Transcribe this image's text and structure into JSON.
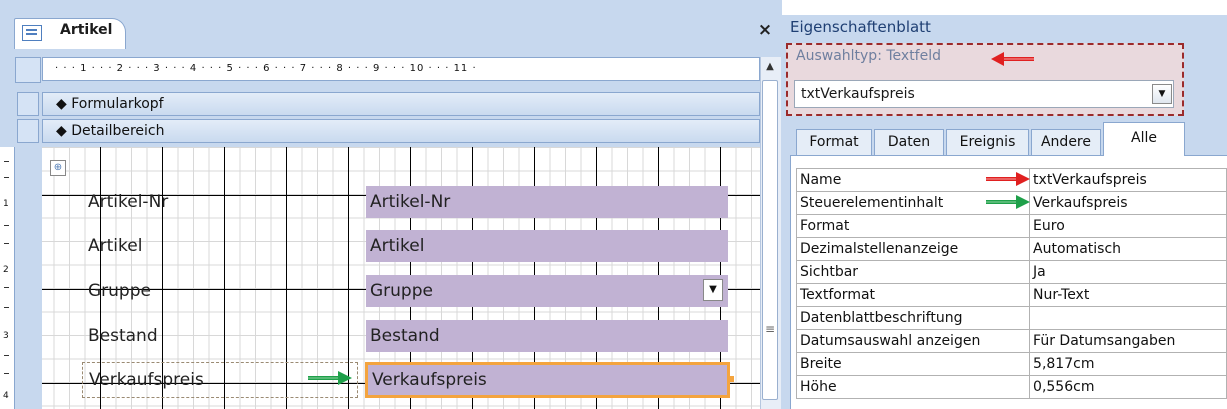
{
  "form_tab": {
    "title": "Artikel",
    "close": "×"
  },
  "ruler": {
    "marks": "· · · 1 · · · 2 · · · 3 · · · 4 · · · 5 · · · 6 · · · 7 · · · 8 · · · 9 · · · 10 · · · 11 ·"
  },
  "vruler": {
    "n1": "1",
    "n2": "2",
    "n3": "3",
    "n4": "4"
  },
  "sections": {
    "header": "Formularkopf",
    "detail": "Detailbereich",
    "marker": "◆"
  },
  "controls": {
    "labels": [
      "Artikel-Nr",
      "Artikel",
      "Gruppe",
      "Bestand",
      "Verkaufspreis"
    ],
    "fields": [
      "Artikel-Nr",
      "Artikel",
      "Gruppe",
      "Bestand",
      "Verkaufspreis"
    ],
    "dropdown_glyph": "▼"
  },
  "scroll": {
    "up": "▲",
    "grip": "≡"
  },
  "property_sheet": {
    "title": "Eigenschaftenblatt",
    "selection_type": "Auswahltyp:  Textfeld",
    "object": "txtVerkaufspreis",
    "tabs": [
      "Format",
      "Daten",
      "Ereignis",
      "Andere",
      "Alle"
    ],
    "active_tab": "Alle",
    "rows": [
      {
        "key": "Name",
        "value": "txtVerkaufspreis"
      },
      {
        "key": "Steuerelementinhalt",
        "value": "Verkaufspreis"
      },
      {
        "key": "Format",
        "value": "Euro"
      },
      {
        "key": "Dezimalstellenanzeige",
        "value": "Automatisch"
      },
      {
        "key": "Sichtbar",
        "value": "Ja"
      },
      {
        "key": "Textformat",
        "value": "Nur-Text"
      },
      {
        "key": "Datenblattbeschriftung",
        "value": ""
      },
      {
        "key": "Datumsauswahl anzeigen",
        "value": "Für Datumsangaben"
      },
      {
        "key": "Breite",
        "value": "5,817cm"
      },
      {
        "key": "Höhe",
        "value": "0,556cm"
      }
    ]
  },
  "colors": {
    "annotation_red": "#e02020",
    "annotation_green": "#1fa04a",
    "selection_orange": "#f4a43e",
    "field_fill": "#c1b2d3",
    "chrome_blue": "#c7d8ee"
  }
}
